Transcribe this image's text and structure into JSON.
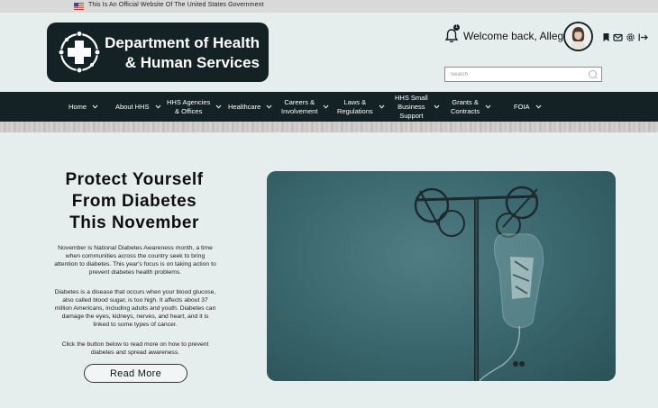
{
  "gov_banner": {
    "text": "This Is An Official Website Of The United States Government",
    "flag_icon": "us-flag-icon"
  },
  "header": {
    "logo_line1": "Department of Health",
    "logo_line2": "& Human Services",
    "notification_count": "1",
    "welcome": "Welcome back, Allegra",
    "search_placeholder": "Search",
    "icons": [
      "bookmark-icon",
      "mail-icon",
      "settings-icon",
      "logout-icon"
    ]
  },
  "nav": {
    "items": [
      {
        "label": "Home"
      },
      {
        "label": "About HHS"
      },
      {
        "label": "HHS Agencies\n& Offices"
      },
      {
        "label": "Healthcare"
      },
      {
        "label": "Careers &\nInvolvement"
      },
      {
        "label": "Laws &\nRegulations"
      },
      {
        "label": "HHS Small\nBusiness\nSupport"
      },
      {
        "label": "Grants &\nContracts"
      },
      {
        "label": "FOIA"
      }
    ]
  },
  "hero": {
    "title_line1": "Protect Yourself",
    "title_line2": "From Diabetes",
    "title_line3": "This November",
    "para1": "November is National Diabetes Awareness month, a time when communities across the country seek to bring attention to diabetes. This year's focus is on taking action to prevent diabetes health problems.",
    "para2": "Diabetes is a disease that occurs when your blood glucose, also called blood sugar, is too high. It affects about 37 million Americans, including adults and youth. Diabetes can damage the eyes, kidneys, nerves, and heart, and it is linked to some types of cancer.",
    "para3": "Click the button below to read more on how to prevent diabetes and spread awareness.",
    "button": "Read More"
  },
  "colors": {
    "nav_bg": "#142226",
    "page_bg": "#e6eded",
    "image_teal": "#3c6a70"
  }
}
